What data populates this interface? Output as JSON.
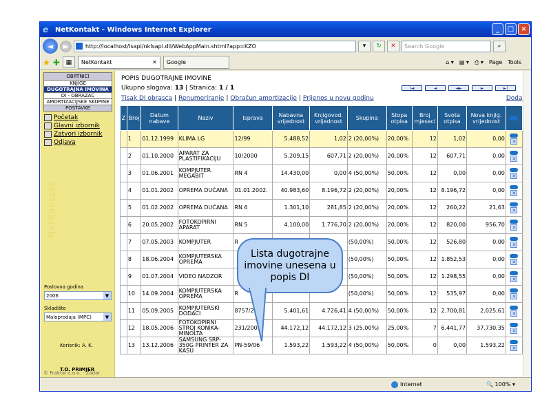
{
  "window": {
    "title": "NetKontakt - Windows Internet Explorer"
  },
  "browser": {
    "url": "http://localhost/Isapi/nkIsapi.dll/WebAppMain.shtml?app=KZO",
    "search_placeholder": "Search Google",
    "tab_active": "NetKontakt",
    "tab_inactive": "Google",
    "tools": [
      "Page",
      "Tools"
    ]
  },
  "sidebar": {
    "header": "OBRTNICI",
    "items": [
      "KNJIGE",
      "DUGOTRAJNA IMOVINA",
      "DI - OBRAZAC",
      "AMORTIZACIJSKE SKUPINE",
      "POSTAVKE"
    ],
    "links": [
      "Početak",
      "Glavni izbornik",
      "Zatvori izbornik",
      "Odjava"
    ],
    "year_label": "Poslovna godina",
    "year_value": "2006",
    "store_label": "Skladište",
    "store_value": "Maloprodaja (MPC)",
    "user": "Korisnik: A. K.",
    "company": "T.O. PRIMJER",
    "copyright": "© Fraktal d.o.o. - Zadar",
    "watermark": "NetKontakt"
  },
  "main": {
    "title": "POPIS DUGOTRAJNE IMOVINE",
    "count_text": "Ukupno slogova:",
    "count": "13",
    "page_text": "| Stranica:",
    "page": "1 / 1",
    "links": [
      "Tisak DI obrasca",
      "Renumeriranje",
      "Obračun amortizacije",
      "Prijenos u novu godinu"
    ],
    "add": "Dodaj",
    "columns": [
      "Z",
      "Broj",
      "Datum nabave",
      "Naziv",
      "Isprava",
      "Nabavna vrijednost",
      "Knjigovod. vrijednost",
      "Skupina",
      "Stopa otpisa",
      "Broj mjeseci",
      "Svota otpisa",
      "Nova knjig. vrijednost"
    ],
    "rows": [
      [
        "",
        "1",
        "01.12.1999",
        "KLIMA LG",
        "12/99",
        "5.488,52",
        "1,02",
        "2 (20,00%)",
        "20,00%",
        "12",
        "1,02",
        "0,00"
      ],
      [
        "",
        "2",
        "01.10.2000",
        "APARAT ZA PLASTIFIKACIJU",
        "10/2000",
        "5.209,15",
        "607,71",
        "2 (20,00%)",
        "20,00%",
        "12",
        "607,71",
        "0,00"
      ],
      [
        "",
        "3",
        "01.06.2001",
        "KOMPJUTER MEGABIT",
        "RN 4",
        "14.430,00",
        "0,00",
        "4 (50,00%)",
        "50,00%",
        "12",
        "0,00",
        "0,00"
      ],
      [
        "",
        "4",
        "01.01.2002",
        "OPREMA DUĆANA",
        "01.01.2002.",
        "40.983,60",
        "8.196,72",
        "2 (20,00%)",
        "20,00%",
        "12",
        "8.196,72",
        "0,00"
      ],
      [
        "",
        "5",
        "01.02.2002",
        "OPREMA DUĆANA",
        "RN 6",
        "1.301,10",
        "281,85",
        "2 (20,00%)",
        "20,00%",
        "12",
        "260,22",
        "21,63"
      ],
      [
        "",
        "6",
        "20.05.2002",
        "FOTOKOPIRNI APARAT",
        "RN 5",
        "4.100,00",
        "1.776,70",
        "2 (20,00%)",
        "20,00%",
        "12",
        "820,00",
        "956,70"
      ],
      [
        "",
        "7",
        "07.05.2003",
        "KOMPJUTER",
        "R",
        "",
        "",
        "(50,00%)",
        "50,00%",
        "12",
        "526,80",
        "0,00"
      ],
      [
        "",
        "8",
        "18.06.2004",
        "KOMPJUTERSKA OPREMA",
        "",
        "",
        "",
        "(50,00%)",
        "50,00%",
        "12",
        "1.852,53",
        "0,00"
      ],
      [
        "",
        "9",
        "01.07.2004",
        "VIDEO NADZOR",
        "",
        "",
        "",
        "(50,00%)",
        "50,00%",
        "12",
        "1.298,55",
        "0,00"
      ],
      [
        "",
        "10",
        "14.09.2004",
        "KOMPJUTERSKA OPREMA",
        "R",
        "",
        "",
        "(50,00%)",
        "50,00%",
        "12",
        "535,97",
        "0,00"
      ],
      [
        "",
        "11",
        "05.09.2005",
        "KOMPJUTERSKI DODACI",
        "8757/2",
        "5.401,61",
        "4.726,41",
        "4 (50,00%)",
        "50,00%",
        "12",
        "2.700,81",
        "2.025,61"
      ],
      [
        "",
        "12",
        "18.05.2006",
        "FOTOKOPIRNI STROJ KONIKA-MINOLTA",
        "231/200",
        "44.172,12",
        "44.172,12",
        "3 (25,00%)",
        "25,00%",
        "7",
        "6.441,77",
        "37.730,35"
      ],
      [
        "",
        "13",
        "13.12.2006",
        "SAMSUNG SRP-350G PRINTER ZA KASU",
        "PN-59/06",
        "1.593,22",
        "1.593,22",
        "4 (50,00%)",
        "50,00%",
        "0",
        "0,00",
        "1.593,22"
      ]
    ]
  },
  "callout": {
    "text": "Lista dugotrajne imovine unesena u popis DI"
  },
  "status": {
    "zone": "Internet",
    "zoom": "100%"
  }
}
